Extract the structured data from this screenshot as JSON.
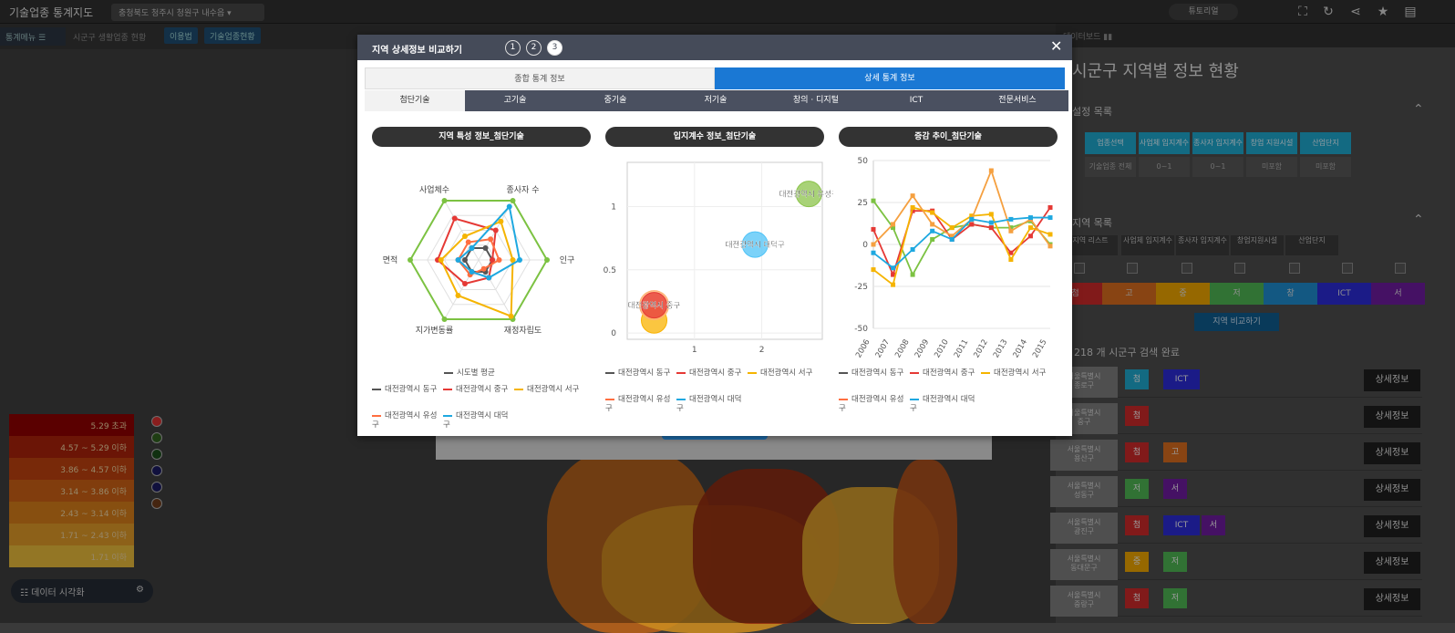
{
  "app": {
    "title": "기술업종 통계지도",
    "region": "충청북도 청주시 청원구 내수읍",
    "tutorial": "튜토리얼"
  },
  "menubar": {
    "menu": "통계메뉴",
    "label": "시군구 생활업종 현황",
    "chips": [
      "이용법",
      "기술업종현황"
    ]
  },
  "legend": {
    "rows": [
      "5.29 초과",
      "4.57 ~ 5.29 이하",
      "3.86 ~ 4.57 이하",
      "3.14 ~ 3.86 이하",
      "2.43 ~ 3.14 이하",
      "1.71 ~ 2.43 이하",
      "1.71 이하"
    ],
    "colors": [
      "#8b0000",
      "#a5210a",
      "#b8400e",
      "#c65f14",
      "#d07a1a",
      "#d99527",
      "#e2b63a"
    ],
    "dots": [
      "#d32f2f",
      "#2e5e1e",
      "#1a4a1a",
      "#1a1a5e",
      "#1a1a5e",
      "#6b3a1a"
    ],
    "viz": "데이터 시각화"
  },
  "panel": {
    "header": "데이터보드",
    "title": "시군구 지역별 정보 현황",
    "settings": "설정 목록",
    "tiles": [
      {
        "h": "업종선택",
        "v": "기술업종 전체"
      },
      {
        "h": "사업체 입지계수",
        "v": "0~1"
      },
      {
        "h": "종사자 입지계수",
        "v": "0~1"
      },
      {
        "h": "창업 지원시설",
        "v": "미포함"
      },
      {
        "h": "산업단지",
        "v": "미포함"
      }
    ],
    "regionList": "지역 목록",
    "cols": [
      "지역 리스트",
      "사업체 입지계수",
      "종사자 입지계수",
      "창업지원시설",
      "산업단지"
    ],
    "catbar": [
      {
        "l": "첨",
        "c": "#c62828"
      },
      {
        "l": "고",
        "c": "#d2691e"
      },
      {
        "l": "중",
        "c": "#e6a000"
      },
      {
        "l": "저",
        "c": "#4caf50"
      },
      {
        "l": "창",
        "c": "#1e88c8"
      },
      {
        "l": "ICT",
        "c": "#2a2ad0"
      },
      {
        "l": "서",
        "c": "#6a1b9a"
      }
    ],
    "compare": "지역 비교하기",
    "count": "218 개 시군구 검색 완료",
    "rows": [
      {
        "n1": "서울특별시",
        "n2": "종로구",
        "tags": [
          {
            "l": "첨",
            "c": "#1ea3c8"
          },
          {
            "l": "ICT",
            "c": "#2a2ad0"
          }
        ]
      },
      {
        "n1": "서울특별시",
        "n2": "중구",
        "tags": [
          {
            "l": "첨",
            "c": "#c62828"
          }
        ]
      },
      {
        "n1": "서울특별시",
        "n2": "용산구",
        "tags": [
          {
            "l": "첨",
            "c": "#c62828"
          },
          {
            "l": "고",
            "c": "#d2691e"
          }
        ]
      },
      {
        "n1": "서울특별시",
        "n2": "성동구",
        "tags": [
          {
            "l": "저",
            "c": "#4caf50"
          },
          {
            "l": "서",
            "c": "#6a1b9a"
          }
        ]
      },
      {
        "n1": "서울특별시",
        "n2": "광진구",
        "tags": [
          {
            "l": "첨",
            "c": "#c62828"
          },
          {
            "l": "ICT",
            "c": "#2a2ad0"
          },
          {
            "l": "서",
            "c": "#6a1b9a"
          }
        ]
      },
      {
        "n1": "서울특별시",
        "n2": "동대문구",
        "tags": [
          {
            "l": "중",
            "c": "#e6a000"
          },
          {
            "l": "저",
            "c": "#4caf50"
          }
        ]
      },
      {
        "n1": "서울특별시",
        "n2": "중랑구",
        "tags": [
          {
            "l": "첨",
            "c": "#c62828"
          },
          {
            "l": "저",
            "c": "#4caf50"
          }
        ]
      }
    ],
    "detail": "상세정보"
  },
  "modal": {
    "title": "지역 상세정보 비교하기",
    "steps": [
      "1",
      "2",
      "3"
    ],
    "tabs": [
      "종합 통계 정보",
      "상세 통계 정보"
    ],
    "subtabs": [
      "첨단기술",
      "고기술",
      "중기술",
      "저기술",
      "창의 · 디지털",
      "ICT",
      "전문서비스"
    ],
    "charts": [
      "지역 특성 정보_첨단기술",
      "입지계수 정보_첨단기술",
      "증감 추이_첨단기술"
    ]
  },
  "series": [
    {
      "name": "대전광역시 동구",
      "color": "#555555"
    },
    {
      "name": "대전광역시 중구",
      "color": "#e53935"
    },
    {
      "name": "대전광역시 서구",
      "color": "#f5b400"
    },
    {
      "name": "대전광역시 유성구",
      "color": "#ff6e40"
    },
    {
      "name": "대전광역시 대덕구",
      "color": "#1ea8e0"
    }
  ],
  "radarAvg": {
    "name": "시도별 평균",
    "color": "#7cc242"
  },
  "chart_data": [
    {
      "type": "radar",
      "title": "지역 특성 정보_첨단기술",
      "axes": [
        "종사자 수",
        "인구",
        "재정자립도",
        "지가변동률",
        "면적",
        "사업체수"
      ],
      "series": [
        {
          "name": "시도별 평균",
          "values": [
            1,
            1,
            1,
            1,
            1,
            1
          ]
        },
        {
          "name": "대전광역시 동구",
          "values": [
            0.2,
            0.2,
            0.2,
            0.2,
            0.2,
            0.2
          ]
        },
        {
          "name": "대전광역시 중구",
          "values": [
            0.5,
            0.2,
            0.3,
            0.4,
            0.6,
            0.7
          ]
        },
        {
          "name": "대전광역시 서구",
          "values": [
            0.65,
            0.5,
            0.95,
            0.6,
            0.55,
            0.4
          ]
        },
        {
          "name": "대전광역시 유성구",
          "values": [
            0.35,
            0.3,
            0.15,
            0.25,
            0.3,
            0.3
          ]
        },
        {
          "name": "대전광역시 대덕구",
          "values": [
            0.9,
            0.6,
            0.3,
            0.2,
            0.3,
            0.2
          ]
        }
      ]
    },
    {
      "type": "scatter",
      "title": "입지계수 정보_첨단기술",
      "xlim": [
        0,
        2.9
      ],
      "ylim": [
        -0.05,
        1.35
      ],
      "xticks": [
        1,
        2
      ],
      "yticks": [
        0,
        0.5,
        1
      ],
      "points": [
        {
          "name": "대전광역시 동구",
          "x": 0.4,
          "y": 0.22
        },
        {
          "name": "대전광역시 중구",
          "x": 0.4,
          "y": 0.22
        },
        {
          "name": "대전광역시 서구",
          "x": 0.4,
          "y": 0.1
        },
        {
          "name": "대전광역시 유성구",
          "x": 2.7,
          "y": 1.1
        },
        {
          "name": "대전광역시 대덕구",
          "x": 1.9,
          "y": 0.7
        }
      ],
      "labels": [
        "대전광역시 중구",
        "대전광역시 유성구",
        "대전광역시 대덕구"
      ]
    },
    {
      "type": "line",
      "title": "증감 추이_첨단기술",
      "x": [
        "2006",
        "2007",
        "2008",
        "2009",
        "2010",
        "2011",
        "2012",
        "2013",
        "2014",
        "2015"
      ],
      "ylim": [
        -50,
        50
      ],
      "yticks": [
        50,
        25,
        0,
        -25,
        -50
      ],
      "series": [
        {
          "name": "대전광역시 동구",
          "values": [
            26,
            10,
            -18,
            3,
            10,
            12,
            10,
            10,
            14,
            0
          ]
        },
        {
          "name": "대전광역시 중구",
          "values": [
            9,
            -18,
            20,
            20,
            3,
            12,
            10,
            -5,
            5,
            22
          ]
        },
        {
          "name": "대전광역시 서구",
          "values": [
            -15,
            -24,
            22,
            19,
            10,
            17,
            18,
            -9,
            10,
            6
          ]
        },
        {
          "name": "대전광역시 유성구",
          "values": [
            0,
            12,
            29,
            12,
            5,
            15,
            44,
            8,
            15,
            -1
          ]
        },
        {
          "name": "대전광역시 대덕구",
          "values": [
            -5,
            -14,
            -3,
            8,
            3,
            15,
            13,
            15,
            16,
            16
          ]
        }
      ]
    }
  ]
}
